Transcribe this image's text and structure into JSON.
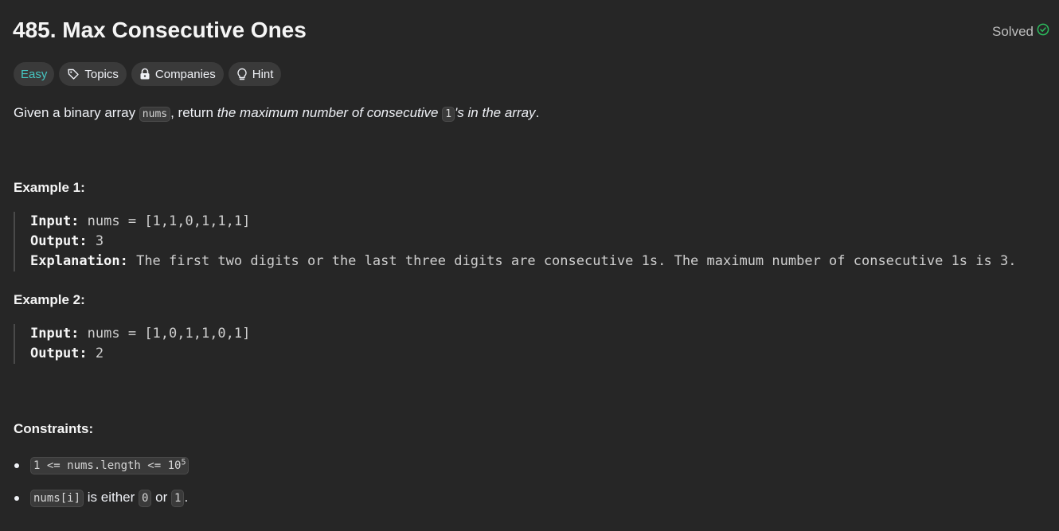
{
  "problem": {
    "title": "485. Max Consecutive Ones",
    "status": "Solved"
  },
  "tags": {
    "difficulty": "Easy",
    "topics": "Topics",
    "companies": "Companies",
    "hint": "Hint"
  },
  "description": {
    "part1": "Given a binary array ",
    "code1": "nums",
    "part2": ", return ",
    "em1": "the maximum number of consecutive ",
    "code2": "1",
    "em2": "'s in the array",
    "end": "."
  },
  "examples": [
    {
      "heading": "Example 1:",
      "input_label": "Input:",
      "input_value": "nums = [1,1,0,1,1,1]",
      "output_label": "Output:",
      "output_value": "3",
      "explanation_label": "Explanation:",
      "explanation_value": "The first two digits or the last three digits are consecutive 1s. The maximum number of consecutive 1s is 3."
    },
    {
      "heading": "Example 2:",
      "input_label": "Input:",
      "input_value": "nums = [1,0,1,1,0,1]",
      "output_label": "Output:",
      "output_value": "2"
    }
  ],
  "constraints": {
    "heading": "Constraints:",
    "c1_code": "1 <= nums.length <= 10",
    "c1_sup": "5",
    "c2_code1": "nums[i]",
    "c2_text1": " is either ",
    "c2_code2": "0",
    "c2_text2": " or ",
    "c2_code3": "1",
    "c2_end": "."
  },
  "colors": {
    "background": "#262626",
    "easy": "#46c6c2",
    "solved_check": "#2cbb5d"
  }
}
